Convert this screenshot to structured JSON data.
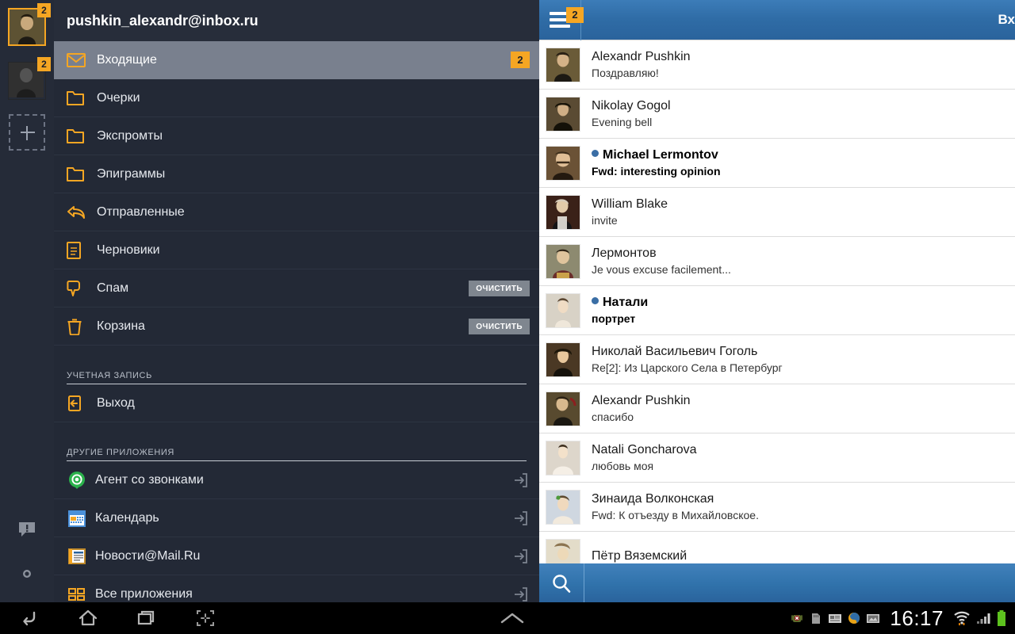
{
  "rail": {
    "accounts": [
      {
        "name": "pushkin-account",
        "badge": "2",
        "active": true
      },
      {
        "name": "secondary-account",
        "badge": "2",
        "active": false
      }
    ],
    "add_label": "+",
    "feedback_icon": "feedback-icon",
    "settings_icon": "gear-icon"
  },
  "drawer": {
    "account_email": "pushkin_alexandr@inbox.ru",
    "folders": [
      {
        "label": "Входящие",
        "icon": "envelope-icon",
        "badge": "2",
        "selected": true,
        "action": ""
      },
      {
        "label": "Очерки",
        "icon": "folder-icon",
        "badge": "",
        "selected": false,
        "action": ""
      },
      {
        "label": "Экспромты",
        "icon": "folder-icon",
        "badge": "",
        "selected": false,
        "action": ""
      },
      {
        "label": "Эпиграммы",
        "icon": "folder-icon",
        "badge": "",
        "selected": false,
        "action": ""
      },
      {
        "label": "Отправленные",
        "icon": "sent-arrow-icon",
        "badge": "",
        "selected": false,
        "action": ""
      },
      {
        "label": "Черновики",
        "icon": "draft-page-icon",
        "badge": "",
        "selected": false,
        "action": ""
      },
      {
        "label": "Спам",
        "icon": "spam-thumb-icon",
        "badge": "",
        "selected": false,
        "action": "ОЧИСТИТЬ"
      },
      {
        "label": "Корзина",
        "icon": "trash-icon",
        "badge": "",
        "selected": false,
        "action": "ОЧИСТИТЬ"
      }
    ],
    "account_section_title": "УЧЕТНАЯ ЗАПИСЬ",
    "logout": {
      "label": "Выход",
      "icon": "logout-icon"
    },
    "apps_section_title": "ДРУГИЕ ПРИЛОЖЕНИЯ",
    "apps": [
      {
        "label": "Агент со звонками",
        "icon": "agent-icon"
      },
      {
        "label": "Календарь",
        "icon": "calendar-icon"
      },
      {
        "label": "Новости@Mail.Ru",
        "icon": "news-icon"
      },
      {
        "label": "Все приложения",
        "icon": "all-apps-icon"
      }
    ]
  },
  "actionbar": {
    "menu_icon": "hamburger-icon",
    "unread_badge": "2",
    "title": "Вх"
  },
  "messages": [
    {
      "from": "Alexandr Pushkin",
      "subject": "Поздравляю!",
      "unread": false
    },
    {
      "from": "Nikolay Gogol",
      "subject": " Evening bell",
      "unread": false
    },
    {
      "from": "Michael Lermontov",
      "subject": "Fwd: interesting opinion",
      "unread": true
    },
    {
      "from": "William Blake",
      "subject": " invite",
      "unread": false
    },
    {
      "from": "Лермонтов",
      "subject": "Je vous excuse facilement...",
      "unread": false
    },
    {
      "from": "Натали",
      "subject": "портрет",
      "unread": true
    },
    {
      "from": "Николай Васильевич Гоголь",
      "subject": "Re[2]: Из Царского Села в Петербург",
      "unread": false
    },
    {
      "from": "Alexandr Pushkin",
      "subject": "спасибо",
      "unread": false
    },
    {
      "from": "Natali Goncharova",
      "subject": "любовь моя",
      "unread": false
    },
    {
      "from": "Зинаида Волконская",
      "subject": "Fwd: К отъезду в Михайловское.",
      "unread": false
    },
    {
      "from": "Пётр Вяземский",
      "subject": "",
      "unread": false
    }
  ],
  "search": {
    "icon": "search-icon",
    "value": "",
    "placeholder": ""
  },
  "navbar": {
    "back_icon": "back-icon",
    "home_icon": "home-icon",
    "recents_icon": "recents-icon",
    "screenshot_icon": "screenshot-icon",
    "expand_icon": "chevron-up-icon",
    "clock": "16:17",
    "status_icons": [
      "android-error-icon",
      "sd-card-icon",
      "news-notification-icon",
      "browser-icon",
      "image-icon",
      "wifi-icon",
      "signal-icon",
      "battery-icon"
    ]
  },
  "colors": {
    "accent_orange": "#f5a623",
    "drawer_bg": "#232936",
    "selected_row": "#79808e",
    "actionbar_blue": "#2f6ca6",
    "unread_dot": "#3a6ea5"
  }
}
